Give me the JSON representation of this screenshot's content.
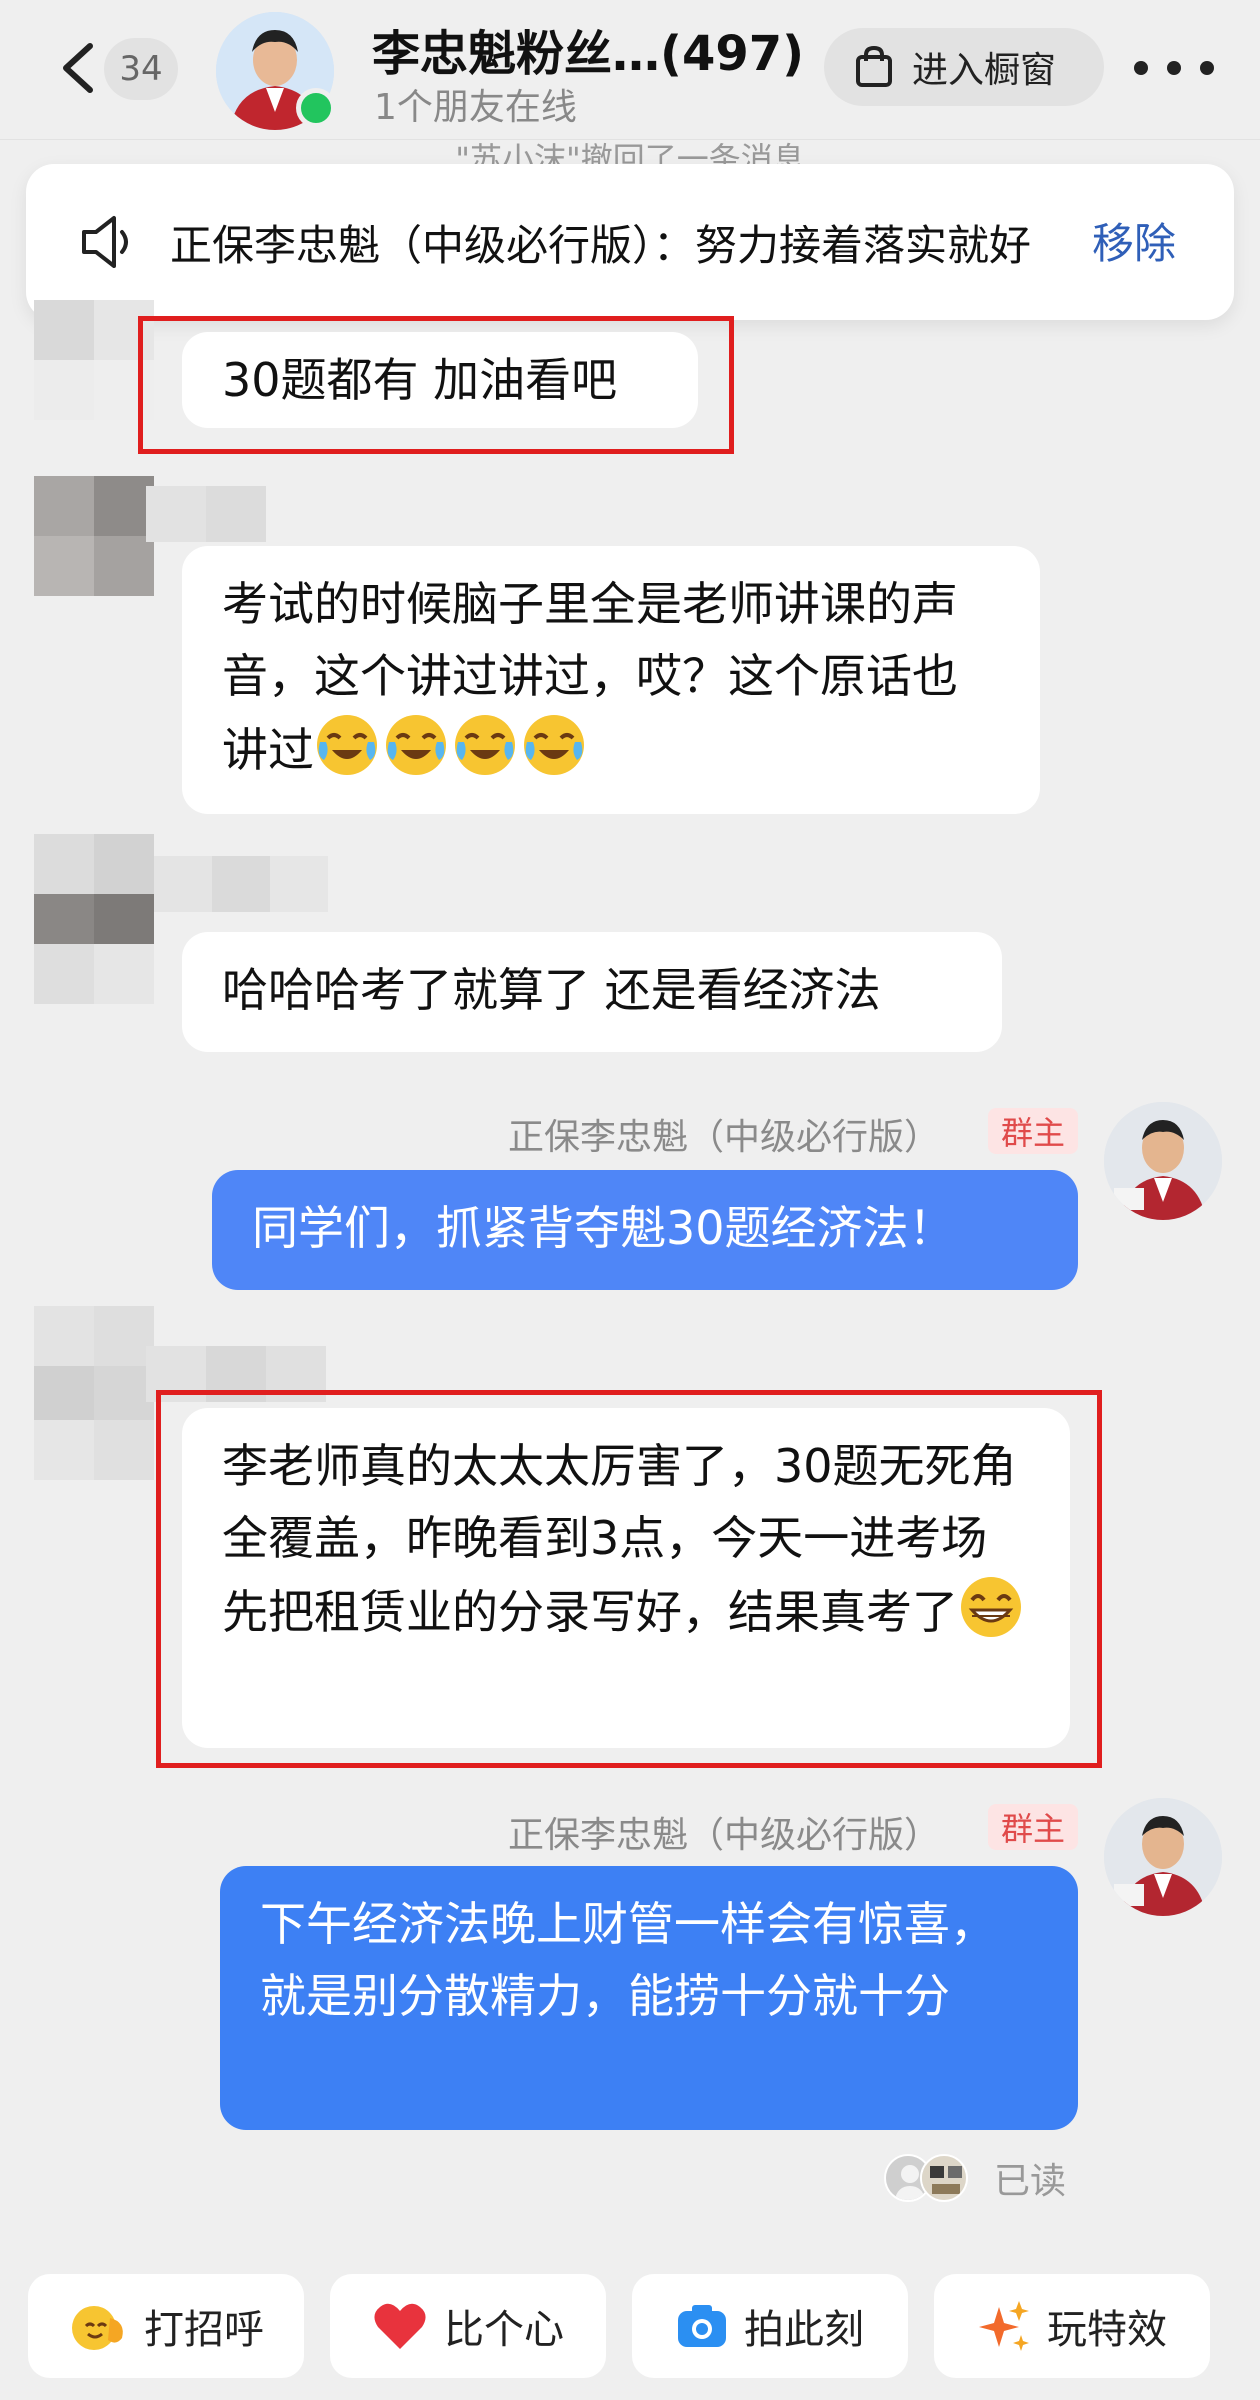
{
  "header": {
    "unread_count": "34",
    "title": "李忠魁粉丝…(497)",
    "subtitle": "1个朋友在线",
    "shop_label": "进入橱窗",
    "back_icon": "chevron-left-icon",
    "more_icon": "more-dots-icon"
  },
  "recall_notice": "\"苏小沫\"撤回了一条消息",
  "pinned": {
    "text": "正保李忠魁（中级必行版）：努力接着落实就好",
    "remove_label": "移除"
  },
  "messages": [
    {
      "side": "left",
      "text": "30题都有 加油看吧",
      "highlighted": true
    },
    {
      "side": "left",
      "text": "考试的时候脑子里全是老师讲课的声音，这个讲过讲过，哎？这个原话也讲过",
      "emoji": "crying-laughing-emoji"
    },
    {
      "side": "left",
      "text": "哈哈哈考了就算了 还是看经济法"
    },
    {
      "side": "right",
      "sender": "正保李忠魁（中级必行版）",
      "badge": "群主",
      "text": "同学们，抓紧背夺魁30题经济法！"
    },
    {
      "side": "left",
      "text": "李老师真的太太太厉害了，30题无死角全覆盖，昨晚看到3点，今天一进考场先把租赁业的分录写好，结果真考了",
      "emoji": "grinning-emoji",
      "highlighted": true
    },
    {
      "side": "right",
      "sender": "正保李忠魁（中级必行版）",
      "badge": "群主",
      "text": "下午经济法晚上财管一样会有惊喜，就是别分散精力，能捞十分就十分"
    }
  ],
  "read_status": "已读",
  "quick_actions": [
    {
      "label": "打招呼",
      "icon": "wave-hand-icon"
    },
    {
      "label": "比个心",
      "icon": "heart-icon"
    },
    {
      "label": "拍此刻",
      "icon": "camera-icon"
    },
    {
      "label": "玩特效",
      "icon": "sparkle-icon"
    }
  ],
  "colors": {
    "background": "#efefef",
    "bubble_self": "#4f86f7",
    "highlight_box": "#e01e1e",
    "owner_badge_text": "#e04a4a",
    "link_blue": "#2f5fb8"
  }
}
